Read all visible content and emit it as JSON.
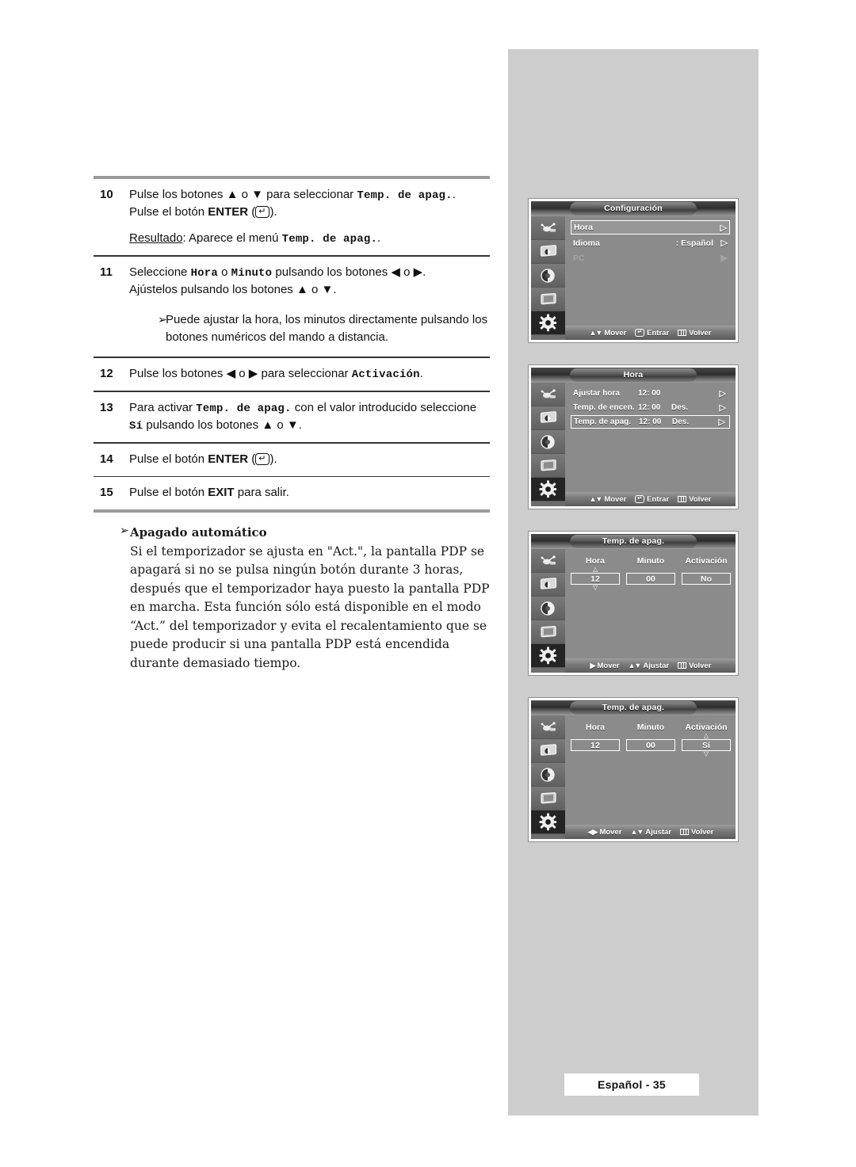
{
  "page": {
    "footer_label": "Español - 35"
  },
  "instructions": {
    "steps": [
      {
        "num": "10",
        "line1_a": "Pulse los botones ▲ o ▼ para seleccionar ",
        "line1_mono": "Temp. de apag.",
        "line1_b": ".",
        "line2_a": "Pulse el botón ",
        "line2_bold": "ENTER",
        "line2_b": " (",
        "line2_c": ").",
        "result_label": "Resultado",
        "result_a": ":  Aparece el menú ",
        "result_mono": "Temp. de apag.",
        "result_b": "."
      },
      {
        "num": "11",
        "line1_a": "Seleccione ",
        "line1_mono1": "Hora",
        "line1_b": " o ",
        "line1_mono2": "Minuto",
        "line1_c": " pulsando los botones ◀ o ▶.",
        "line2": "Ajústelos pulsando los botones ▲ o ▼.",
        "note_arrow": "➢",
        "note": "Puede ajustar la hora, los minutos directamente pulsando los botones numéricos del mando a distancia."
      },
      {
        "num": "12",
        "line1_a": "Pulse los botones ◀ o ▶ para seleccionar ",
        "line1_mono": "Activación",
        "line1_b": "."
      },
      {
        "num": "13",
        "line1_a": "Para activar ",
        "line1_mono": "Temp. de apag.",
        "line1_b": " con el valor introducido seleccione ",
        "line2_mono": "Sí",
        "line2_b": " pulsando los botones ▲ o ▼."
      },
      {
        "num": "14",
        "line1_a": "Pulse el botón ",
        "line1_bold": "ENTER",
        "line1_b": " (",
        "line1_c": ")."
      },
      {
        "num": "15",
        "line1_a": "Pulse el botón ",
        "line1_bold": "EXIT",
        "line1_b": " para salir."
      }
    ],
    "auto_power": {
      "arrow": "➢",
      "title": "Apagado automático",
      "text": "Si el temporizador se ajusta en \"Act.\", la pantalla PDP se apagará si no se pulsa ningún botón durante 3 horas, después que el temporizador haya puesto la pantalla PDP en marcha. Esta función sólo está disponible en el modo “Act.” del temporizador y evita el recalentamiento que se puede producir si una pantalla PDP está encendida durante demasiado tiempo."
    }
  },
  "osd_screens": [
    {
      "id": "configuracion",
      "title": "Configuración",
      "rows": [
        {
          "label": "Hora",
          "value": "",
          "state": "",
          "arrow": "▷",
          "selected": true,
          "dim": false
        },
        {
          "label": "Idioma",
          "value": ": Español",
          "state": "",
          "arrow": "▷",
          "selected": false,
          "dim": false
        },
        {
          "label": "PC",
          "value": "",
          "state": "",
          "arrow": "▶",
          "selected": false,
          "dim": true
        }
      ],
      "footer": [
        {
          "glyph": "updown",
          "label": "Mover"
        },
        {
          "glyph": "enter",
          "label": "Entrar"
        },
        {
          "glyph": "menu",
          "label": "Volver"
        }
      ]
    },
    {
      "id": "hora",
      "title": "Hora",
      "rows": [
        {
          "label": "Ajustar hora",
          "value": "12: 00",
          "state": "",
          "arrow": "▷",
          "selected": false,
          "dim": false
        },
        {
          "label": "Temp. de encen.",
          "value": "12: 00",
          "state": "Des.",
          "arrow": "▷",
          "selected": false,
          "dim": false
        },
        {
          "label": "Temp. de apag.",
          "value": "12: 00",
          "state": "Des.",
          "arrow": "▷",
          "selected": true,
          "dim": false
        }
      ],
      "footer": [
        {
          "glyph": "updown",
          "label": "Mover"
        },
        {
          "glyph": "enter",
          "label": "Entrar"
        },
        {
          "glyph": "menu",
          "label": "Volver"
        }
      ]
    },
    {
      "id": "temp-apag-no",
      "title": "Temp. de apag.",
      "fields": [
        {
          "head": "Hora",
          "value": "12",
          "carets": true
        },
        {
          "head": "Minuto",
          "value": "00",
          "carets": false
        },
        {
          "head": "Activación",
          "value": "No",
          "carets": false
        }
      ],
      "footer": [
        {
          "glyph": "right",
          "label": "Mover"
        },
        {
          "glyph": "updown",
          "label": "Ajustar"
        },
        {
          "glyph": "menu",
          "label": "Volver"
        }
      ]
    },
    {
      "id": "temp-apag-si",
      "title": "Temp. de apag.",
      "fields": [
        {
          "head": "Hora",
          "value": "12",
          "carets": false
        },
        {
          "head": "Minuto",
          "value": "00",
          "carets": false
        },
        {
          "head": "Activación",
          "value": "Sí",
          "carets": true
        }
      ],
      "footer": [
        {
          "glyph": "leftright",
          "label": "Mover"
        },
        {
          "glyph": "updown",
          "label": "Ajustar"
        },
        {
          "glyph": "menu",
          "label": "Volver"
        }
      ]
    }
  ],
  "osd_icons": [
    {
      "name": "input-source-icon",
      "active": false
    },
    {
      "name": "picture-icon",
      "active": false
    },
    {
      "name": "sound-icon",
      "active": false
    },
    {
      "name": "pip-icon",
      "active": false
    },
    {
      "name": "setup-gear-icon",
      "active": true
    }
  ],
  "colors": {
    "panel_bg": "#cdcdcd",
    "osd_bg": "#8b8b8b",
    "rule_thick": "#9b9b9b",
    "rule_thin": "#333333"
  }
}
